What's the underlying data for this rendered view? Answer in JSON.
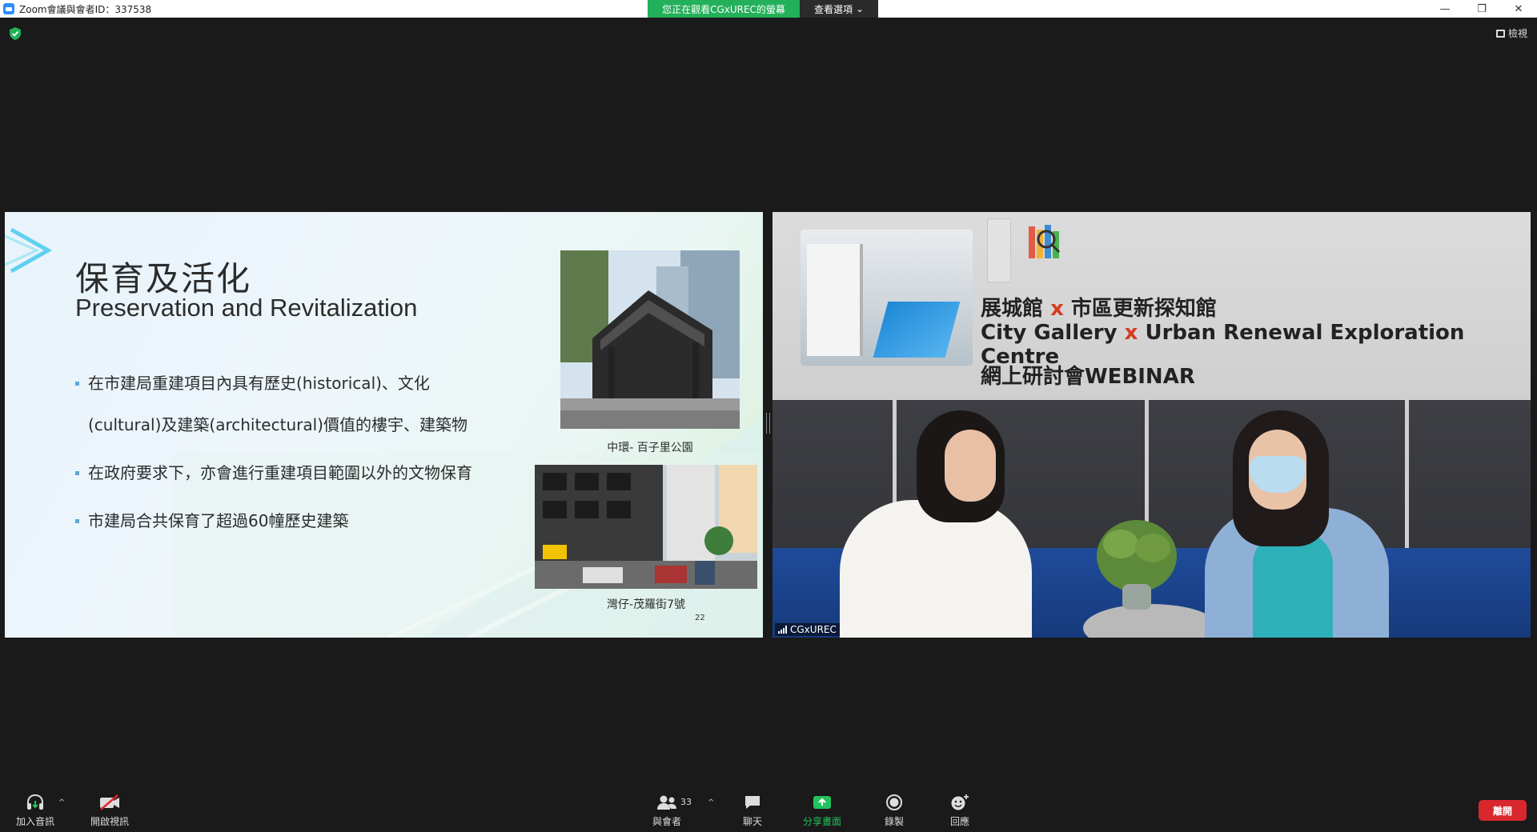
{
  "window": {
    "title": "Zoom會議與會者ID：337538",
    "viewing_banner": "您正在觀看CGxUREC的螢幕",
    "view_options": "查看選項",
    "minimize": "—",
    "restore": "❐",
    "close": "✕",
    "view_button": "檢視"
  },
  "slide": {
    "title_zh": "保育及活化",
    "title_en": "Preservation and Revitalization",
    "bullets": [
      "在市建局重建項目內具有歷史(historical)、文化",
      "(cultural)及建築(architectural)價值的樓宇、建築物",
      "在政府要求下，亦會進行重建項目範圍以外的文物保育",
      "市建局合共保育了超過60幢歷史建築"
    ],
    "captions": [
      "中環- 百子里公園",
      "灣仔-茂羅街7號"
    ],
    "page_number": "22"
  },
  "video": {
    "banner_line1_a": "展城館",
    "banner_line1_x": "x",
    "banner_line1_b": "市區更新探知館",
    "banner_line2_a": "City Gallery",
    "banner_line2_x": "x",
    "banner_line2_b": "Urban Renewal Exploration Centre",
    "banner_line3": "網上研討會WEBINAR",
    "participant_name": "CGxUREC"
  },
  "toolbar": {
    "audio_label": "加入音訊",
    "video_label": "開啟視訊",
    "participants_label": "與會者",
    "participants_count": "33",
    "chat_label": "聊天",
    "share_label": "分享畫面",
    "record_label": "錄製",
    "reactions_label": "回應",
    "end_label": "離開",
    "caret": "^"
  },
  "colors": {
    "share_green": "#23c35e",
    "end_red": "#d9272e",
    "banner_green": "#23b05a",
    "accent_x": "#d63b1f"
  }
}
